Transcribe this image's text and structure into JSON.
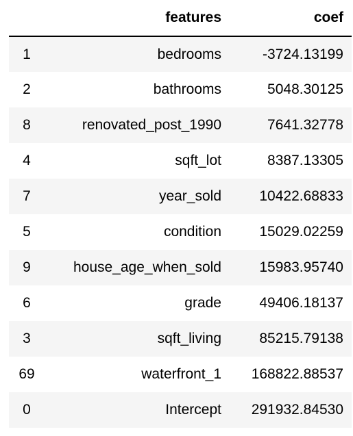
{
  "table": {
    "columns": {
      "index": "",
      "features": "features",
      "coef": "coef"
    },
    "rows": [
      {
        "index": "1",
        "features": "bedrooms",
        "coef": "-3724.13199"
      },
      {
        "index": "2",
        "features": "bathrooms",
        "coef": "5048.30125"
      },
      {
        "index": "8",
        "features": "renovated_post_1990",
        "coef": "7641.32778"
      },
      {
        "index": "4",
        "features": "sqft_lot",
        "coef": "8387.13305"
      },
      {
        "index": "7",
        "features": "year_sold",
        "coef": "10422.68833"
      },
      {
        "index": "5",
        "features": "condition",
        "coef": "15029.02259"
      },
      {
        "index": "9",
        "features": "house_age_when_sold",
        "coef": "15983.95740"
      },
      {
        "index": "6",
        "features": "grade",
        "coef": "49406.18137"
      },
      {
        "index": "3",
        "features": "sqft_living",
        "coef": "85215.79138"
      },
      {
        "index": "69",
        "features": "waterfront_1",
        "coef": "168822.88537"
      },
      {
        "index": "0",
        "features": "Intercept",
        "coef": "291932.84530"
      }
    ]
  },
  "colors": {
    "stripe": "#f5f5f5",
    "background": "#ffffff",
    "header_rule": "#000000"
  }
}
